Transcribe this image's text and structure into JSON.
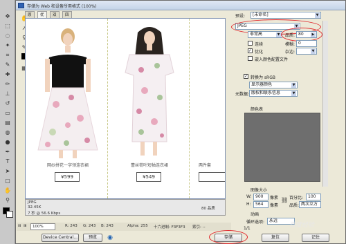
{
  "dialog": {
    "title": "存储为 Web 和设备所用格式 (100%)"
  },
  "view_tabs": [
    "原稿",
    "优化",
    "双联",
    "四联"
  ],
  "products": [
    {
      "caption": "网纱拼花一字领连衣裙",
      "price": "¥599"
    },
    {
      "caption": "蕾丝荷叶短袖连衣裙",
      "price": "¥549"
    },
    {
      "caption": "两件套",
      "price": ""
    }
  ],
  "info": {
    "format": "JPEG",
    "size": "32.45K",
    "time": "7 秒 @ 56.6 Kbps",
    "quality": "80 品质"
  },
  "status": {
    "zoom": "100%",
    "r": "R: 243",
    "g": "G: 243",
    "b": "B: 243",
    "alpha": "Alpha: 255",
    "hex": "十六进制: F3F3F3",
    "index": "索引: --"
  },
  "buttons": {
    "device_central": "Device Central...",
    "preview": "预览",
    "save": "存储",
    "reset": "复位",
    "remember": "记住"
  },
  "panel": {
    "preset_label": "预设:",
    "preset_value": "[未命名]",
    "format_value": "JPEG",
    "compression_value": "非常高",
    "quality_label": "品质:",
    "quality_value": "80",
    "progressive_label": "连续",
    "blur_label": "模糊:",
    "blur_value": "0",
    "optimized_label": "优化",
    "matte_label": "杂边:",
    "icc_label": "嵌入颜色配置文件",
    "srgb_label": "转换为 sRGB",
    "preview_value": "显示器颜色",
    "metadata_label": "元数据:",
    "metadata_value": "版权和联系信息",
    "color_table_label": "颜色表",
    "image_size_label": "图像大小",
    "w_label": "W:",
    "w_value": "900",
    "h_label": "H:",
    "h_value": "564",
    "px_label": "像素",
    "percent_label": "百分比:",
    "percent_value": "100",
    "quality2_label": "品质:",
    "quality2_value": "两次立方",
    "animation_label": "动画",
    "loop_label": "循环选项:",
    "loop_value": "永远",
    "frame_counter": "1/1"
  },
  "watermark": "百度经验",
  "colors": {
    "highlight": "#e0262b"
  }
}
